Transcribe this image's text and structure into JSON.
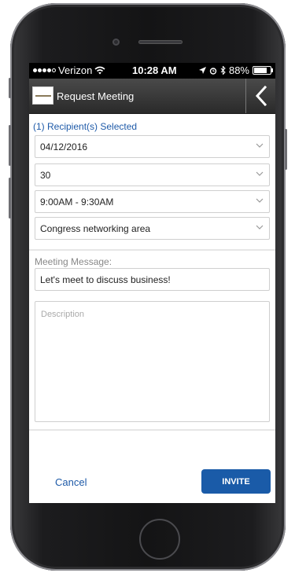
{
  "status_bar": {
    "carrier": "Verizon",
    "time": "10:28 AM",
    "battery": "88%",
    "battery_level": 0.88
  },
  "header": {
    "title": "Request Meeting",
    "logo_icon": "app-logo-icon",
    "back_icon": "chevron-left-icon"
  },
  "form": {
    "recipients_label": "(1) Recipient(s) Selected",
    "date_value": "04/12/2016",
    "duration_value": "30",
    "time_slot_value": "9:00AM - 9:30AM",
    "location_value": "Congress networking area",
    "message_label": "Meeting Message:",
    "message_value": "Let's meet to discuss business!",
    "description_placeholder": "Description"
  },
  "actions": {
    "cancel_label": "Cancel",
    "invite_label": "INVITE"
  },
  "colors": {
    "accent": "#1e5aa8",
    "invite_button": "#1a5ba8",
    "header_bg": "#3a3a3a"
  }
}
